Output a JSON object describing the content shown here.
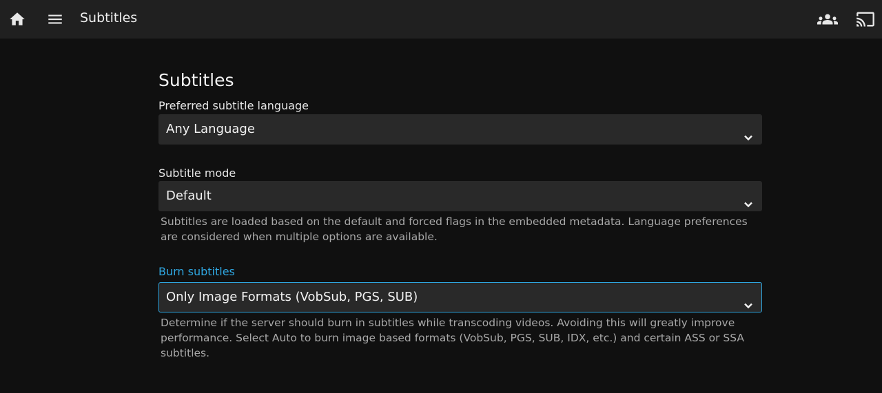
{
  "header": {
    "title": "Subtitles",
    "icons": {
      "home": "home-icon",
      "menu": "menu-icon",
      "users": "users-icon",
      "cast": "cast-icon"
    }
  },
  "page": {
    "heading": "Subtitles"
  },
  "fields": {
    "language": {
      "label": "Preferred subtitle language",
      "value": "Any Language"
    },
    "mode": {
      "label": "Subtitle mode",
      "value": "Default",
      "help": "Subtitles are loaded based on the default and forced flags in the embedded metadata. Language preferences are considered when multiple options are available."
    },
    "burn": {
      "label": "Burn subtitles",
      "value": "Only Image Formats (VobSub, PGS, SUB)",
      "help": "Determine if the server should burn in subtitles while transcoding videos. Avoiding this will greatly improve performance. Select Auto to burn image based formats (VobSub, PGS, SUB, IDX, etc.) and certain ASS or SSA subtitles."
    }
  },
  "colors": {
    "accent": "#2fa6e0",
    "background": "#101010",
    "header": "#202020",
    "field": "#292929"
  }
}
